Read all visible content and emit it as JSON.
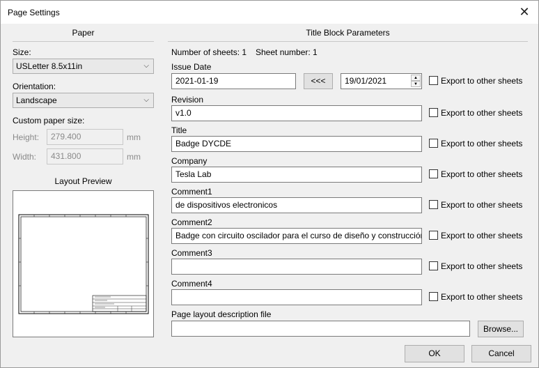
{
  "window": {
    "title": "Page Settings",
    "close_glyph": "✕"
  },
  "paper": {
    "heading": "Paper",
    "size_label": "Size:",
    "size_value": "USLetter 8.5x11in",
    "orientation_label": "Orientation:",
    "orientation_value": "Landscape",
    "custom_label": "Custom paper size:",
    "height_label": "Height:",
    "height_value": "279.400",
    "height_unit": "mm",
    "width_label": "Width:",
    "width_value": "431.800",
    "width_unit": "mm",
    "preview_heading": "Layout Preview"
  },
  "title_block": {
    "heading": "Title Block Parameters",
    "num_sheets": "Number of sheets: 1",
    "sheet_number": "Sheet number: 1",
    "issue_date_label": "Issue Date",
    "issue_date_value": "2021-01-19",
    "copy_date_button": "<<<",
    "date_picker_value": "19/01/2021",
    "revision_label": "Revision",
    "revision_value": "v1.0",
    "title_label": "Title",
    "title_value": "Badge DYCDE",
    "company_label": "Company",
    "company_value": "Tesla Lab",
    "comment1_label": "Comment1",
    "comment1_value": "de dispositivos electronicos",
    "comment2_label": "Comment2",
    "comment2_value": "Badge con circuito oscilador para el curso de diseño y construcción",
    "comment3_label": "Comment3",
    "comment3_value": "",
    "comment4_label": "Comment4",
    "comment4_value": "",
    "layout_file_label": "Page layout description file",
    "layout_file_value": "",
    "browse_button": "Browse...",
    "export_label": "Export to other sheets"
  },
  "footer": {
    "ok_button": "OK",
    "cancel_button": "Cancel"
  },
  "icons": {
    "dropdown": "chevron-down-icon",
    "close": "close-icon",
    "spin_up": "spin-up-icon",
    "spin_down": "spin-down-icon"
  }
}
